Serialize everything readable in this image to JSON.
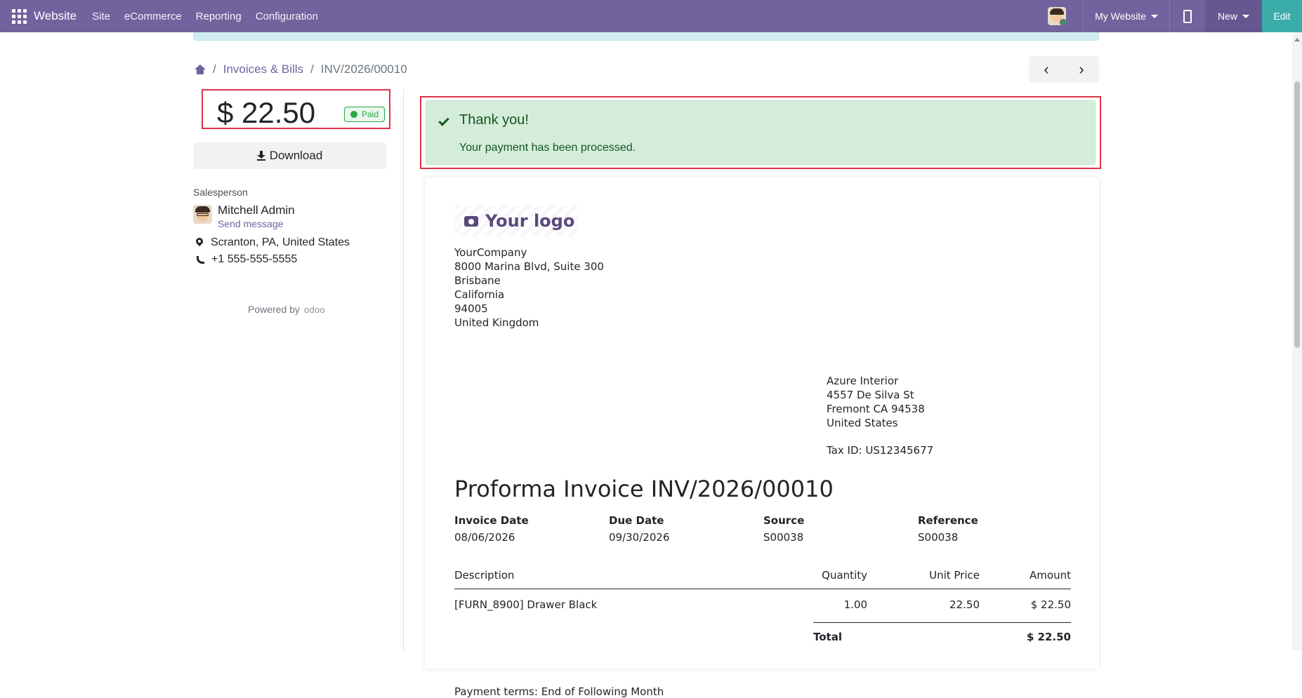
{
  "topbar": {
    "brand": "Website",
    "menu": [
      "Site",
      "eCommerce",
      "Reporting",
      "Configuration"
    ],
    "website_selector": "My Website",
    "new_label": "New",
    "edit_label": "Edit"
  },
  "breadcrumb": {
    "parent": "Invoices & Bills",
    "current": "INV/2026/00010",
    "separator": "/"
  },
  "pager": {
    "prev": "‹",
    "next": "›"
  },
  "sidebar": {
    "amount": "$ 22.50",
    "status": "Paid",
    "download_label": "Download",
    "salesperson_label": "Salesperson",
    "salesperson_name": "Mitchell Admin",
    "send_message": "Send message",
    "location": "Scranton, PA, United States",
    "phone": "+1 555-555-5555",
    "powered_by": "Powered by",
    "powered_brand": "odoo"
  },
  "alert": {
    "title": "Thank you!",
    "message": "Your payment has been processed."
  },
  "invoice": {
    "logo_text": "Your logo",
    "company": [
      "YourCompany",
      "8000 Marina Blvd, Suite 300",
      "Brisbane",
      "California",
      "94005",
      "United Kingdom"
    ],
    "client": [
      "Azure Interior",
      "4557 De Silva St",
      "Fremont CA 94538",
      "United States"
    ],
    "tax_id": "Tax ID: US12345677",
    "title": "Proforma Invoice INV/2026/00010",
    "meta": [
      {
        "label": "Invoice Date",
        "value": "08/06/2026"
      },
      {
        "label": "Due Date",
        "value": "09/30/2026"
      },
      {
        "label": "Source",
        "value": "S00038"
      },
      {
        "label": "Reference",
        "value": "S00038"
      }
    ],
    "columns": {
      "description": "Description",
      "quantity": "Quantity",
      "unit_price": "Unit Price",
      "amount": "Amount"
    },
    "lines": [
      {
        "description": "[FURN_8900] Drawer Black",
        "quantity": "1.00",
        "unit_price": "22.50",
        "amount": "$ 22.50"
      }
    ],
    "total_label": "Total",
    "total_value": "$ 22.50",
    "payment_terms": "Payment terms: End of Following Month"
  },
  "colors": {
    "navbar": "#71639e",
    "edit_button": "#3aadaa",
    "success_bg": "#d4edda",
    "success_text": "#155724",
    "highlight_border": "#dc3545",
    "paid_green": "#28a745"
  }
}
